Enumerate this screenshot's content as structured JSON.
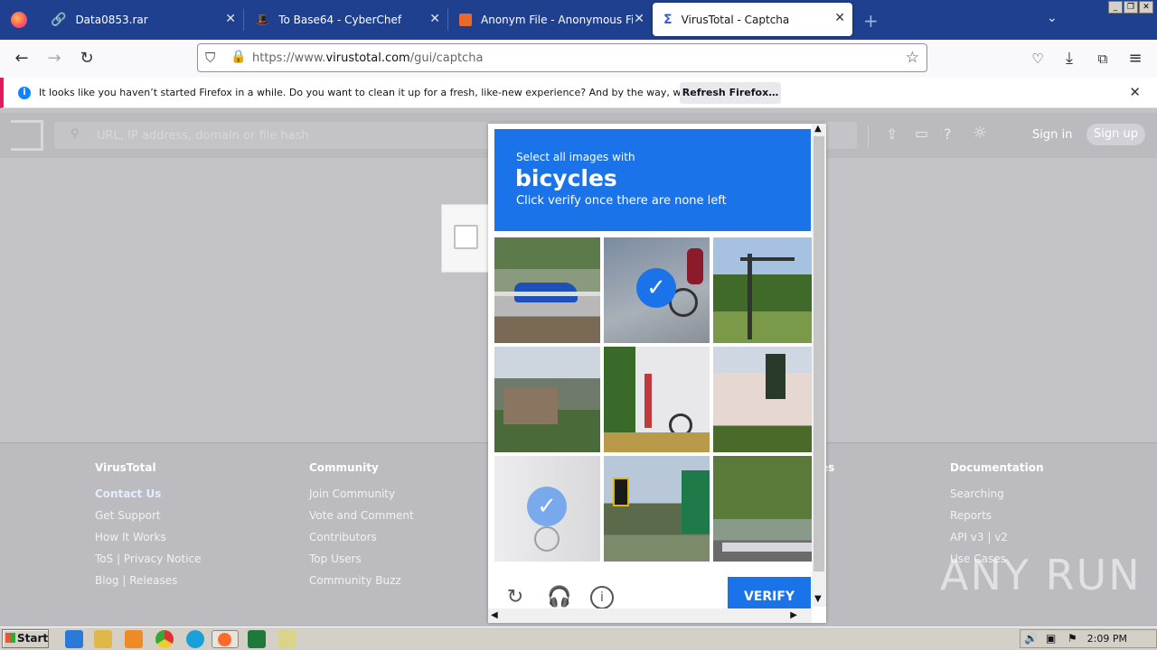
{
  "browser": {
    "tabs": [
      {
        "title": "Data0853.rar"
      },
      {
        "title": "To Base64 - CyberChef"
      },
      {
        "title": "Anonym File - Anonymous File Uplo"
      },
      {
        "title": "VirusTotal - Captcha"
      }
    ],
    "url_prefix": "https://www.",
    "url_domain": "virustotal.com",
    "url_path": "/gui/captcha"
  },
  "notification": {
    "message": "It looks like you haven’t started Firefox in a while. Do you want to clean it up for a fresh, like-new experience? And by the way, welcome back!",
    "button": "Refresh Firefox…"
  },
  "vt": {
    "search_placeholder": "URL, IP address, domain or file hash",
    "sign_in": "Sign in",
    "sign_up": "Sign up"
  },
  "footer": {
    "virustotal": {
      "title": "VirusTotal",
      "links": [
        "Contact Us",
        "Get Support",
        "How It Works",
        "ToS | Privacy Notice",
        "Blog | Releases"
      ]
    },
    "community": {
      "title": "Community",
      "links": [
        "Join Community",
        "Vote and Comment",
        "Contributors",
        "Top Users",
        "Community Buzz"
      ]
    },
    "partial_heading": "es",
    "documentation": {
      "title": "Documentation",
      "links": [
        "Searching",
        "Reports",
        "API v3 | v2",
        "Use Cases"
      ]
    }
  },
  "captcha": {
    "line1": "Select all images with",
    "keyword": "bicycles",
    "line3": "Click verify once there are none left",
    "verify": "VERIFY",
    "tiles": [
      {
        "selected": false
      },
      {
        "selected": true
      },
      {
        "selected": false
      },
      {
        "selected": false
      },
      {
        "selected": false
      },
      {
        "selected": false
      },
      {
        "selected": true
      },
      {
        "selected": false
      },
      {
        "selected": false
      }
    ]
  },
  "taskbar": {
    "start": "Start",
    "clock": "2:09 PM"
  },
  "watermark": "ANY RUN"
}
